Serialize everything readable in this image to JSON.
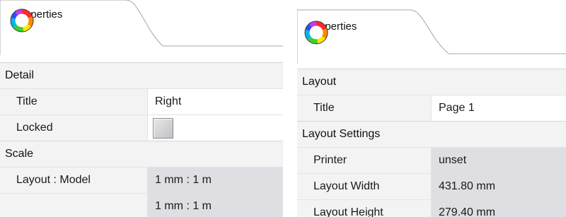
{
  "left_panel": {
    "tab": {
      "label": "Properties",
      "icon": "color-wheel-icon"
    },
    "sections": [
      {
        "title": "Detail",
        "rows": [
          {
            "label": "Title",
            "value": "Right"
          },
          {
            "label": "Locked",
            "checked": false
          }
        ]
      },
      {
        "title": "Scale",
        "rows": [
          {
            "label": "Layout : Model",
            "value": "1 mm : 1 m"
          },
          {
            "label": "",
            "value": "1 mm : 1 m"
          }
        ]
      }
    ]
  },
  "right_panel": {
    "tab": {
      "label": "Properties",
      "icon": "color-wheel-icon"
    },
    "sections": [
      {
        "title": "Layout",
        "rows": [
          {
            "label": "Title",
            "value": "Page 1"
          }
        ]
      },
      {
        "title": "Layout Settings",
        "rows": [
          {
            "label": "Printer",
            "value": "unset"
          },
          {
            "label": "Layout Width",
            "value": "431.80 mm"
          },
          {
            "label": "Layout Height",
            "value": "279.40 mm"
          }
        ]
      }
    ]
  },
  "colors": {
    "section_bg": "#f3f3f3",
    "readonly_value_bg": "#dedee3",
    "tab_border": "#a8a8a8"
  }
}
